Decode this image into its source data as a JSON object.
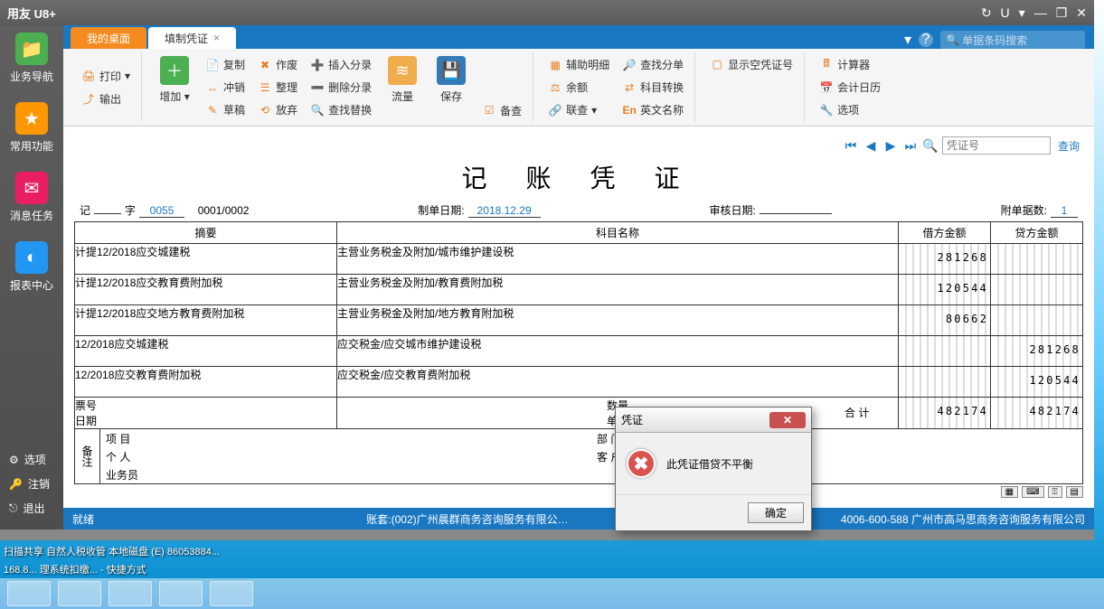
{
  "titlebar": {
    "app_name": "用友 U8+"
  },
  "tabs": {
    "home": "我的桌面",
    "active": "填制凭证"
  },
  "search": {
    "placeholder": "单据条码搜索"
  },
  "leftnav": {
    "biz": "业务导航",
    "fav": "常用功能",
    "msg": "消息任务",
    "rpt": "报表中心",
    "opt": "选项",
    "logout": "注销",
    "exit": "退出"
  },
  "ribbon": {
    "add": "增加",
    "print": "打印",
    "output": "输出",
    "copy": "复制",
    "offset": "冲销",
    "draft": "草稿",
    "void": "作废",
    "tidy": "整理",
    "abandon": "放弃",
    "ins_entry": "插入分录",
    "del_entry": "删除分录",
    "find_replace": "查找替换",
    "flow": "流量",
    "save": "保存",
    "audit": "备查",
    "aux": "辅助明细",
    "balance": "余额",
    "linkq": "联查",
    "find_bill": "查找分单",
    "acct_trans": "科目转换",
    "eng_name": "英文名称",
    "show_empty": "显示空凭证号",
    "calc": "计算器",
    "acct_cal": "会计日历",
    "options": "选项"
  },
  "voucher_nav": {
    "placeholder": "凭证号",
    "query": "查询"
  },
  "voucher": {
    "title": "记 账 凭 证",
    "ji": "记",
    "zi": "字",
    "no": "0055",
    "seq": "0001/0002",
    "make_date_lbl": "制单日期:",
    "make_date": "2018.12.29",
    "audit_date_lbl": "审核日期:",
    "attach_lbl": "附单据数:",
    "attach": "1",
    "cols": {
      "summary": "摘要",
      "subject": "科目名称",
      "debit": "借方金额",
      "credit": "贷方金额"
    },
    "rows": [
      {
        "summary": "计提12/2018应交城建税",
        "subject": "主营业务税金及附加/城市维护建设税",
        "debit": "281268",
        "credit": ""
      },
      {
        "summary": "计提12/2018应交教育费附加税",
        "subject": "主营业务税金及附加/教育费附加税",
        "debit": "120544",
        "credit": ""
      },
      {
        "summary": "计提12/2018应交地方教育费附加税",
        "subject": "主营业务税金及附加/地方教育附加税",
        "debit": "80662",
        "credit": ""
      },
      {
        "summary": "12/2018应交城建税",
        "subject": "应交税金/应交城市维护建设税",
        "debit": "",
        "credit": "281268"
      },
      {
        "summary": "12/2018应交教育费附加税",
        "subject": "应交税金/应交教育费附加税",
        "debit": "",
        "credit": "120544"
      }
    ],
    "sum_label": "合 计",
    "sum_debit": "482174",
    "sum_credit": "482174",
    "meta": {
      "ticket": "票号",
      "date": "日期",
      "qty": "数量",
      "price": "单价"
    },
    "footer": {
      "remark": "备注",
      "project": "项 目",
      "dept": "部 门",
      "person": "个 人",
      "customer": "客 户",
      "clerk": "业务员"
    }
  },
  "statusbar": {
    "ready": "就绪",
    "acct_set": "账套:(002)广州晨群商务咨询服务有限公…",
    "hotline": "4006-600-588 广州市高马思商务咨询服务有限公司"
  },
  "dialog": {
    "title": "凭证",
    "message": "此凭证借贷不平衡",
    "ok": "确定"
  },
  "desktop": {
    "l1": "扫描共享  自然人税收管  本地磁盘 (E)   86053884...",
    "l2": "168.8...  理系统扣缴...  - 快捷方式"
  }
}
